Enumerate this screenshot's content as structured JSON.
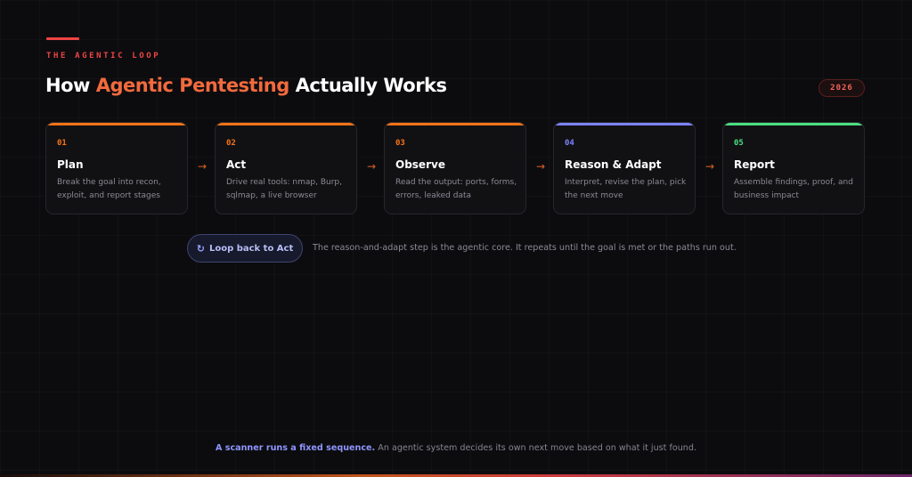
{
  "header": {
    "eyebrow": "THE AGENTIC LOOP",
    "title_prefix": "How ",
    "title_highlight": "Agentic Pentesting",
    "title_suffix": " Actually Works",
    "year": "2026"
  },
  "colors": {
    "accent_red": "#ef4444",
    "accent_orange": "#f26a3d",
    "accent_purple": "#8f96ff",
    "accent_green": "#4ade80"
  },
  "steps": [
    {
      "number": "01",
      "title": "Plan",
      "description": "Break the goal into recon, exploit, and report stages",
      "color": "#f97316"
    },
    {
      "number": "02",
      "title": "Act",
      "description": "Drive real tools: nmap, Burp, sqlmap, a live browser",
      "color": "#f97316"
    },
    {
      "number": "03",
      "title": "Observe",
      "description": "Read the output: ports, forms, errors, leaked data",
      "color": "#f97316"
    },
    {
      "number": "04",
      "title": "Reason & Adapt",
      "description": "Interpret, revise the plan, pick the next move",
      "color": "#7c83ff"
    },
    {
      "number": "05",
      "title": "Report",
      "description": "Assemble findings, proof, and business impact",
      "color": "#4ade80"
    }
  ],
  "arrows": [
    "→",
    "→",
    "→",
    "→"
  ],
  "loop": {
    "icon": "↻",
    "button_label": "Loop back to Act",
    "note": "The reason-and-adapt step is the agentic core. It repeats until the goal is met or the paths run out."
  },
  "footer": {
    "strong": "A scanner runs a fixed sequence.",
    "rest": " An agentic system decides its own next move based on what it just found."
  }
}
